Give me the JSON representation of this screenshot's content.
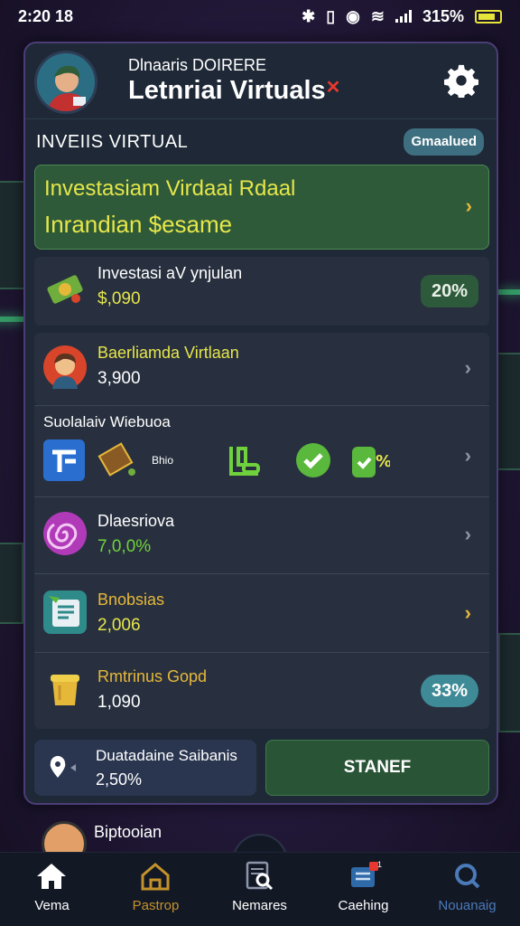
{
  "status_bar": {
    "time": "2:20 18",
    "battery": "315%"
  },
  "header": {
    "subtitle": "Dlnaaris DOIRERE",
    "title": "Letnriai Virtuals",
    "title_badge": "✕"
  },
  "section": {
    "title": "INVEIIS VIRTUAL",
    "status": "Gmaalued"
  },
  "banner": {
    "line1": "Investasiam Virdaai Rdaal",
    "line2": "Inrandian $esame"
  },
  "rows": [
    {
      "label": "Investasi aV ynjulan",
      "value": "$,090",
      "badge": "20%"
    },
    {
      "label": "Baerliamda Virtlaan",
      "value": "3,900"
    },
    {
      "label": "Suolalaiv Wiebuoa",
      "small_label": "Bhio"
    },
    {
      "label": "Dlaesriova",
      "value": "7,0,0%"
    },
    {
      "label": "Bnobsias",
      "value": "2,006"
    },
    {
      "label": "Rmtrinus Gopd",
      "value": "1,090",
      "badge": "33%"
    }
  ],
  "bottom": {
    "left_label": "Duatadaine Saibanis",
    "left_value": "2,50%",
    "button": "STANEF"
  },
  "peek": {
    "label": "Biptooian"
  },
  "nav": [
    {
      "label": "Vema",
      "icon": "home-icon"
    },
    {
      "label": "Pastrop",
      "icon": "house-outline-icon"
    },
    {
      "label": "Nemares",
      "icon": "search-document-icon"
    },
    {
      "label": "Caehing",
      "icon": "message-icon",
      "badge": "1"
    },
    {
      "label": "Nouanaig",
      "icon": "search-icon"
    }
  ],
  "colors": {
    "accent_green": "#3fd27c",
    "accent_yellow": "#e6e64a",
    "panel": "#1e2836",
    "badge_teal": "#3e6f80"
  }
}
